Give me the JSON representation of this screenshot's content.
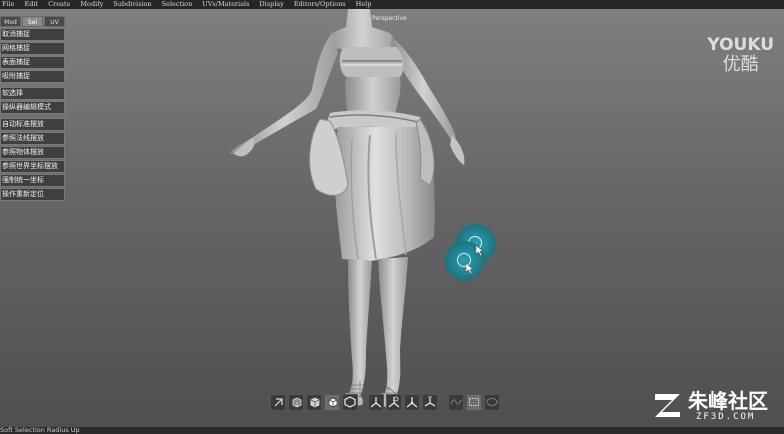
{
  "menu": [
    "File",
    "Edit",
    "Create",
    "Modify",
    "Subdivision",
    "Selection",
    "UVs/Materials",
    "Display",
    "Editors/Options",
    "Help"
  ],
  "viewport": {
    "label": "Perspective"
  },
  "shelf": {
    "tabs": [
      "Mod",
      "Sel",
      "UV"
    ],
    "active_tab": "Sel",
    "buttons": [
      "取消捕捉",
      "网格捕捉",
      "表面捕捉",
      "吸附捕捉",
      "软选择",
      "操纵器编辑模式",
      "自动标准摆放",
      "参照法线摆放",
      "参照物体摆放",
      "参照世界坐标摆放",
      "强制统一坐标",
      "操作重新定位"
    ]
  },
  "toolbar": {
    "icons": [
      "rotate-tool-icon",
      "cube-front-icon",
      "cube-solid-icon",
      "cube-highlight-icon",
      "hexagon-icon",
      "axis-icon",
      "axis-rotate-icon",
      "axis-alt-icon",
      "axis-world-icon",
      "curve-select-icon",
      "marquee-select-icon",
      "lasso-select-icon"
    ],
    "selected": 3
  },
  "status": "Soft Selection Radius Up",
  "watermarks": {
    "youku_en": "YOUKU",
    "youku_cn": "优酷",
    "zf_cn": "朱峰社区",
    "zf_en": "ZF3D.COM"
  },
  "colors": {
    "viewport_top": "#7f7f7f",
    "viewport_bottom": "#4f4f4f",
    "soft_select": "#2aa3b5",
    "menubar": "#262626"
  }
}
